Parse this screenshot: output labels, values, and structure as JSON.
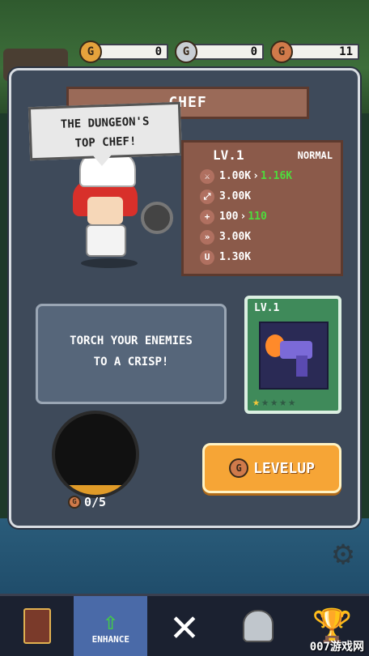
{
  "currencies": [
    {
      "icon": "gold-coin-icon",
      "symbol": "G",
      "value": "0",
      "color": "#e6a23c"
    },
    {
      "icon": "silver-coin-icon",
      "symbol": "G",
      "value": "0",
      "color": "#c9cfd4"
    },
    {
      "icon": "bronze-coin-icon",
      "symbol": "G",
      "value": "11",
      "color": "#d07a4a"
    }
  ],
  "hero": {
    "name": "CHEF",
    "quote_line1": "THE DUNGEON'S",
    "quote_line2": "TOP CHEF!",
    "level": "LV.1",
    "rarity": "NORMAL",
    "stats": [
      {
        "icon": "sword-icon",
        "base": "1.00K",
        "upgraded": "1.16K"
      },
      {
        "icon": "expand-arrows-icon",
        "base": "3.00K",
        "upgraded": ""
      },
      {
        "icon": "health-plus-icon",
        "base": "100",
        "upgraded": "110"
      },
      {
        "icon": "speed-wing-icon",
        "base": "3.00K",
        "upgraded": ""
      },
      {
        "icon": "magnet-icon",
        "base": "1.30K",
        "upgraded": ""
      }
    ]
  },
  "description": {
    "line1": "TORCH YOUR ENEMIES",
    "line2": "TO A CRISP!"
  },
  "weapon": {
    "level": "LV.1",
    "stars_filled": 1,
    "stars_total": 5
  },
  "cauldron": {
    "count": "0/5",
    "fill_fraction": 0.0
  },
  "levelup_button": {
    "label": "LEVELUP"
  },
  "nav": {
    "items": [
      {
        "name": "book",
        "label": ""
      },
      {
        "name": "enhance",
        "label": "ENHANCE"
      },
      {
        "name": "close",
        "label": ""
      },
      {
        "name": "helmet",
        "label": ""
      },
      {
        "name": "trophy",
        "label": ""
      }
    ]
  },
  "watermark": "007游戏网",
  "colors": {
    "panel": "#3e4a5a",
    "stat_up": "#4ddc3c",
    "levelup": "#f6a536",
    "enhance_active": "#4a6aa8"
  }
}
